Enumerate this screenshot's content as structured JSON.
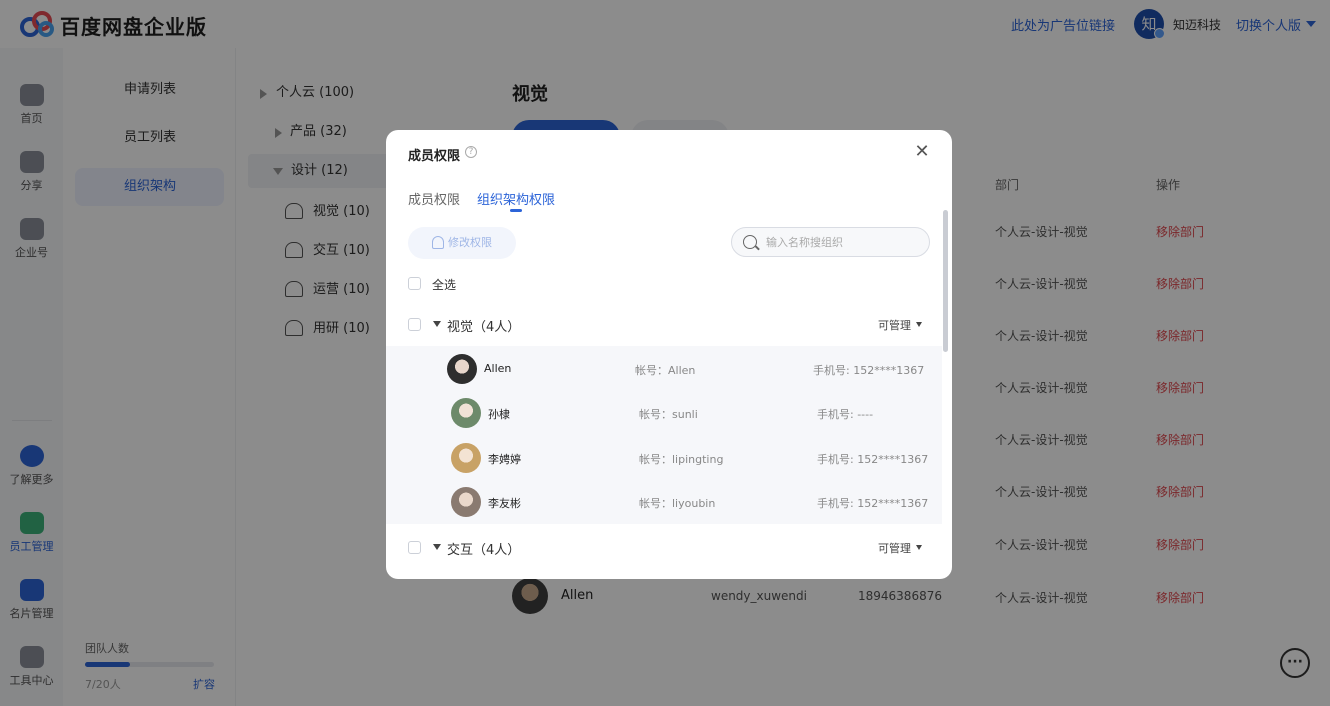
{
  "header": {
    "app_title": "百度网盘企业版",
    "ad_link": "此处为广告位链接",
    "avatar_char": "知",
    "company": "知迈科技",
    "switch_label": "切换个人版"
  },
  "rail": {
    "items": [
      {
        "label": "首页",
        "icon": "cloud-icon"
      },
      {
        "label": "分享",
        "icon": "share-icon"
      },
      {
        "label": "企业号",
        "icon": "shield-icon"
      },
      {
        "label": "了解更多",
        "icon": "more-icon"
      },
      {
        "label": "员工管理",
        "icon": "employee-icon"
      },
      {
        "label": "名片管理",
        "icon": "card-icon"
      },
      {
        "label": "工具中心",
        "icon": "tools-icon"
      }
    ]
  },
  "subnav": {
    "items": [
      "申请列表",
      "员工列表",
      "组织架构"
    ],
    "team_label": "团队人数",
    "team_count": "7/20人",
    "team_progress": 0.35,
    "expand_label": "扩容"
  },
  "tree": {
    "nodes": [
      "个人云 (100)",
      "产品 (32)",
      "设计 (12)",
      "视觉 (10)",
      "交互 (10)",
      "运营 (10)",
      "用研 (10)"
    ]
  },
  "main": {
    "title": "视觉",
    "col_department": "部门",
    "col_action": "操作",
    "dept_value": "个人云-设计-视觉",
    "remove_label": "移除部门",
    "last_row": {
      "name": "Allen",
      "account": "wendy_xuwendi",
      "phone": "18946386876"
    }
  },
  "modal": {
    "title": "成员权限",
    "tabs": [
      "成员权限",
      "组织架构权限"
    ],
    "edit_button": "修改权限",
    "search_placeholder": "输入名称搜组织",
    "select_all": "全选",
    "groups": [
      {
        "name": "视觉（4人）",
        "perm": "可管理"
      },
      {
        "name": "交互（4人）",
        "perm": "可管理"
      }
    ],
    "members": [
      {
        "name": "Allen",
        "account": "帐号：Allen",
        "phone": "手机号: 152****1367"
      },
      {
        "name": "孙棣",
        "account": "帐号：sunli",
        "phone": "手机号: ----"
      },
      {
        "name": "李娉婷",
        "account": "帐号：lipingting",
        "phone": "手机号: 152****1367"
      },
      {
        "name": "李友彬",
        "account": "帐号：liyoubin",
        "phone": "手机号: 152****1367"
      }
    ]
  },
  "colors": {
    "accent": "#2c64d8",
    "danger": "#e0474e",
    "active_green": "#3db37a"
  }
}
